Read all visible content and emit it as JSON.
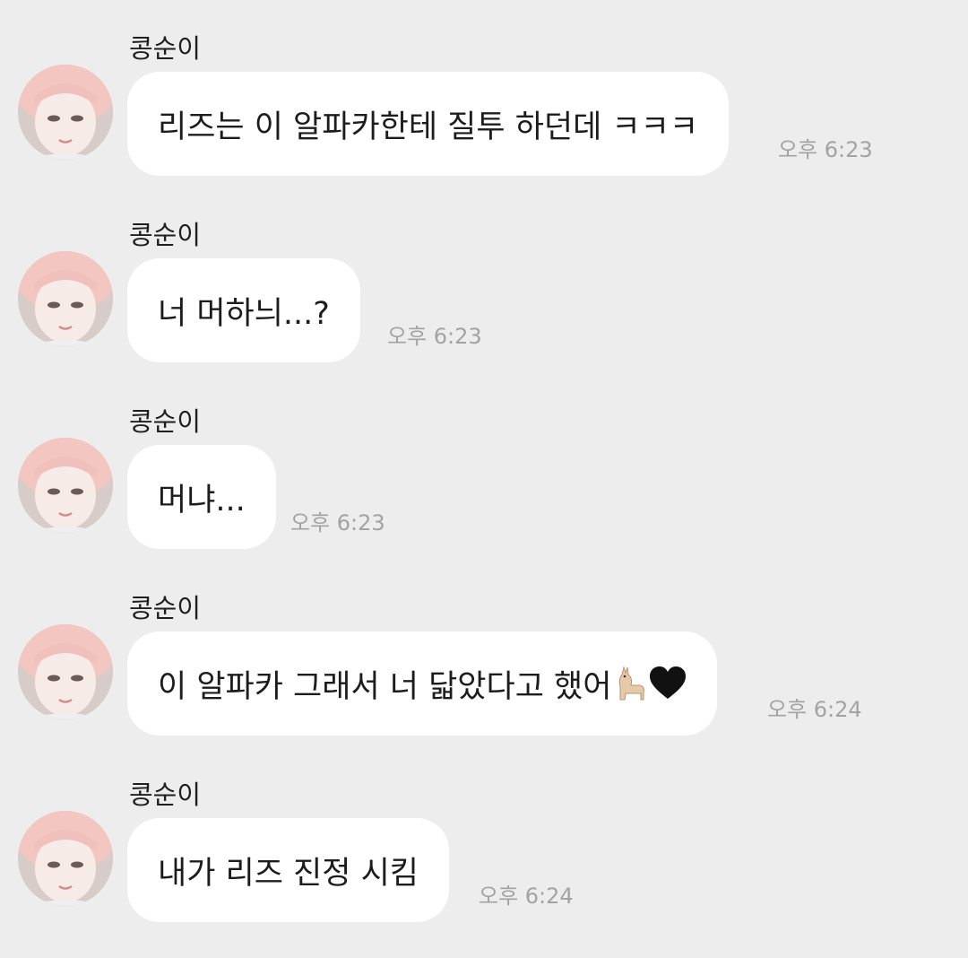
{
  "messages": [
    {
      "sender": "콩순이",
      "text": "리즈는 이 알파카한테 질투 하던데 ㅋㅋㅋ",
      "time": "오후 6:23"
    },
    {
      "sender": "콩순이",
      "text": "너 머하늬...?",
      "time": "오후 6:23"
    },
    {
      "sender": "콩순이",
      "text": "머냐...",
      "time": "오후 6:23"
    },
    {
      "sender": "콩순이",
      "text": "이 알파카 그래서 너 닯았다고 했어",
      "emoji": [
        "llama-emoji",
        "black-heart-emoji"
      ],
      "time": "오후 6:24"
    },
    {
      "sender": "콩순이",
      "text": "내가 리즈 진정 시킴",
      "time": "오후 6:24"
    }
  ],
  "colors": {
    "background": "#ededed",
    "bubble": "#ffffff",
    "text": "#1c1c1c",
    "timestamp": "#a3a3a3"
  }
}
